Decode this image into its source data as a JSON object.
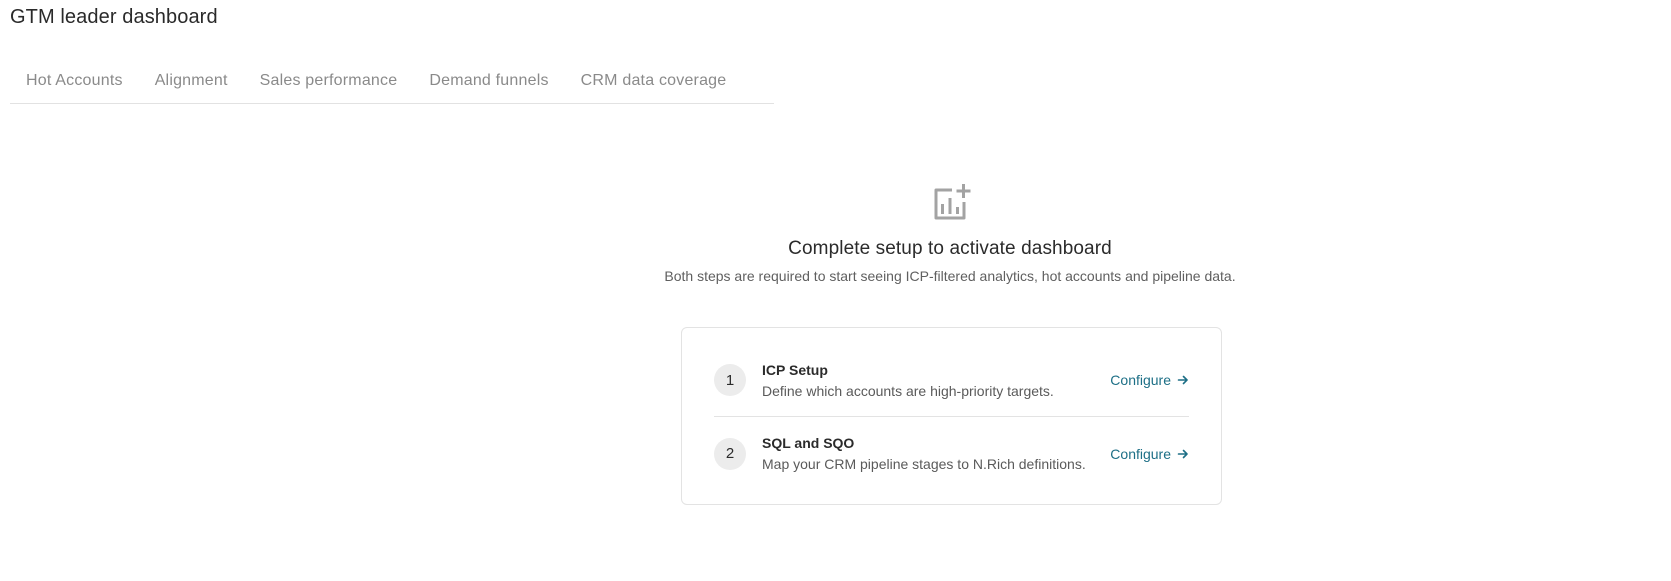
{
  "page": {
    "title": "GTM leader dashboard"
  },
  "tabs": [
    {
      "label": "Hot Accounts"
    },
    {
      "label": "Alignment"
    },
    {
      "label": "Sales performance"
    },
    {
      "label": "Demand funnels"
    },
    {
      "label": "CRM data coverage"
    }
  ],
  "empty_state": {
    "icon": "add-chart-icon",
    "title": "Complete setup to activate dashboard",
    "subtitle": "Both steps are required to start seeing ICP-filtered analytics, hot accounts and pipeline data."
  },
  "steps": [
    {
      "number": "1",
      "title": "ICP Setup",
      "description": "Define which accounts are high-priority targets.",
      "action_label": "Configure",
      "action_icon": "arrow-right-icon"
    },
    {
      "number": "2",
      "title": "SQL and SQO",
      "description": "Map your CRM pipeline stages to N.Rich definitions.",
      "action_label": "Configure",
      "action_icon": "arrow-right-icon"
    }
  ],
  "colors": {
    "link": "#1d6f86",
    "icon": "#9a9a9a",
    "tab_text": "#8a8a8a",
    "border": "#e3e3e3"
  }
}
